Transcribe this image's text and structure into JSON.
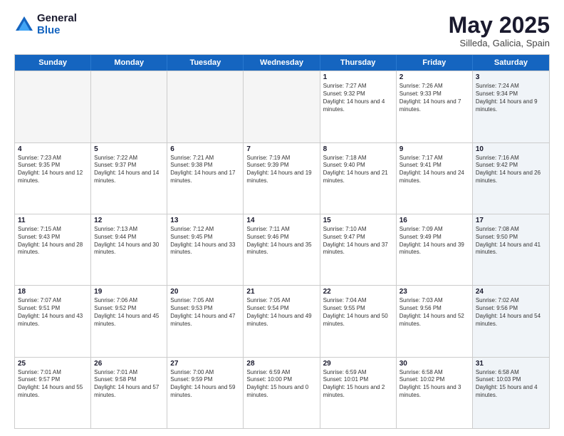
{
  "logo": {
    "general": "General",
    "blue": "Blue"
  },
  "title": {
    "month_year": "May 2025",
    "location": "Silleda, Galicia, Spain"
  },
  "days_of_week": [
    "Sunday",
    "Monday",
    "Tuesday",
    "Wednesday",
    "Thursday",
    "Friday",
    "Saturday"
  ],
  "rows": [
    [
      {
        "day": "",
        "empty": true
      },
      {
        "day": "",
        "empty": true
      },
      {
        "day": "",
        "empty": true
      },
      {
        "day": "",
        "empty": true
      },
      {
        "day": "1",
        "sunrise": "Sunrise: 7:27 AM",
        "sunset": "Sunset: 9:32 PM",
        "daylight": "Daylight: 14 hours and 4 minutes."
      },
      {
        "day": "2",
        "sunrise": "Sunrise: 7:26 AM",
        "sunset": "Sunset: 9:33 PM",
        "daylight": "Daylight: 14 hours and 7 minutes."
      },
      {
        "day": "3",
        "sunrise": "Sunrise: 7:24 AM",
        "sunset": "Sunset: 9:34 PM",
        "daylight": "Daylight: 14 hours and 9 minutes.",
        "shaded": true
      }
    ],
    [
      {
        "day": "4",
        "sunrise": "Sunrise: 7:23 AM",
        "sunset": "Sunset: 9:35 PM",
        "daylight": "Daylight: 14 hours and 12 minutes."
      },
      {
        "day": "5",
        "sunrise": "Sunrise: 7:22 AM",
        "sunset": "Sunset: 9:37 PM",
        "daylight": "Daylight: 14 hours and 14 minutes."
      },
      {
        "day": "6",
        "sunrise": "Sunrise: 7:21 AM",
        "sunset": "Sunset: 9:38 PM",
        "daylight": "Daylight: 14 hours and 17 minutes."
      },
      {
        "day": "7",
        "sunrise": "Sunrise: 7:19 AM",
        "sunset": "Sunset: 9:39 PM",
        "daylight": "Daylight: 14 hours and 19 minutes."
      },
      {
        "day": "8",
        "sunrise": "Sunrise: 7:18 AM",
        "sunset": "Sunset: 9:40 PM",
        "daylight": "Daylight: 14 hours and 21 minutes."
      },
      {
        "day": "9",
        "sunrise": "Sunrise: 7:17 AM",
        "sunset": "Sunset: 9:41 PM",
        "daylight": "Daylight: 14 hours and 24 minutes."
      },
      {
        "day": "10",
        "sunrise": "Sunrise: 7:16 AM",
        "sunset": "Sunset: 9:42 PM",
        "daylight": "Daylight: 14 hours and 26 minutes.",
        "shaded": true
      }
    ],
    [
      {
        "day": "11",
        "sunrise": "Sunrise: 7:15 AM",
        "sunset": "Sunset: 9:43 PM",
        "daylight": "Daylight: 14 hours and 28 minutes."
      },
      {
        "day": "12",
        "sunrise": "Sunrise: 7:13 AM",
        "sunset": "Sunset: 9:44 PM",
        "daylight": "Daylight: 14 hours and 30 minutes."
      },
      {
        "day": "13",
        "sunrise": "Sunrise: 7:12 AM",
        "sunset": "Sunset: 9:45 PM",
        "daylight": "Daylight: 14 hours and 33 minutes."
      },
      {
        "day": "14",
        "sunrise": "Sunrise: 7:11 AM",
        "sunset": "Sunset: 9:46 PM",
        "daylight": "Daylight: 14 hours and 35 minutes."
      },
      {
        "day": "15",
        "sunrise": "Sunrise: 7:10 AM",
        "sunset": "Sunset: 9:47 PM",
        "daylight": "Daylight: 14 hours and 37 minutes."
      },
      {
        "day": "16",
        "sunrise": "Sunrise: 7:09 AM",
        "sunset": "Sunset: 9:49 PM",
        "daylight": "Daylight: 14 hours and 39 minutes."
      },
      {
        "day": "17",
        "sunrise": "Sunrise: 7:08 AM",
        "sunset": "Sunset: 9:50 PM",
        "daylight": "Daylight: 14 hours and 41 minutes.",
        "shaded": true
      }
    ],
    [
      {
        "day": "18",
        "sunrise": "Sunrise: 7:07 AM",
        "sunset": "Sunset: 9:51 PM",
        "daylight": "Daylight: 14 hours and 43 minutes."
      },
      {
        "day": "19",
        "sunrise": "Sunrise: 7:06 AM",
        "sunset": "Sunset: 9:52 PM",
        "daylight": "Daylight: 14 hours and 45 minutes."
      },
      {
        "day": "20",
        "sunrise": "Sunrise: 7:05 AM",
        "sunset": "Sunset: 9:53 PM",
        "daylight": "Daylight: 14 hours and 47 minutes."
      },
      {
        "day": "21",
        "sunrise": "Sunrise: 7:05 AM",
        "sunset": "Sunset: 9:54 PM",
        "daylight": "Daylight: 14 hours and 49 minutes."
      },
      {
        "day": "22",
        "sunrise": "Sunrise: 7:04 AM",
        "sunset": "Sunset: 9:55 PM",
        "daylight": "Daylight: 14 hours and 50 minutes."
      },
      {
        "day": "23",
        "sunrise": "Sunrise: 7:03 AM",
        "sunset": "Sunset: 9:56 PM",
        "daylight": "Daylight: 14 hours and 52 minutes."
      },
      {
        "day": "24",
        "sunrise": "Sunrise: 7:02 AM",
        "sunset": "Sunset: 9:56 PM",
        "daylight": "Daylight: 14 hours and 54 minutes.",
        "shaded": true
      }
    ],
    [
      {
        "day": "25",
        "sunrise": "Sunrise: 7:01 AM",
        "sunset": "Sunset: 9:57 PM",
        "daylight": "Daylight: 14 hours and 55 minutes."
      },
      {
        "day": "26",
        "sunrise": "Sunrise: 7:01 AM",
        "sunset": "Sunset: 9:58 PM",
        "daylight": "Daylight: 14 hours and 57 minutes."
      },
      {
        "day": "27",
        "sunrise": "Sunrise: 7:00 AM",
        "sunset": "Sunset: 9:59 PM",
        "daylight": "Daylight: 14 hours and 59 minutes."
      },
      {
        "day": "28",
        "sunrise": "Sunrise: 6:59 AM",
        "sunset": "Sunset: 10:00 PM",
        "daylight": "Daylight: 15 hours and 0 minutes."
      },
      {
        "day": "29",
        "sunrise": "Sunrise: 6:59 AM",
        "sunset": "Sunset: 10:01 PM",
        "daylight": "Daylight: 15 hours and 2 minutes."
      },
      {
        "day": "30",
        "sunrise": "Sunrise: 6:58 AM",
        "sunset": "Sunset: 10:02 PM",
        "daylight": "Daylight: 15 hours and 3 minutes."
      },
      {
        "day": "31",
        "sunrise": "Sunrise: 6:58 AM",
        "sunset": "Sunset: 10:03 PM",
        "daylight": "Daylight: 15 hours and 4 minutes.",
        "shaded": true
      }
    ]
  ]
}
